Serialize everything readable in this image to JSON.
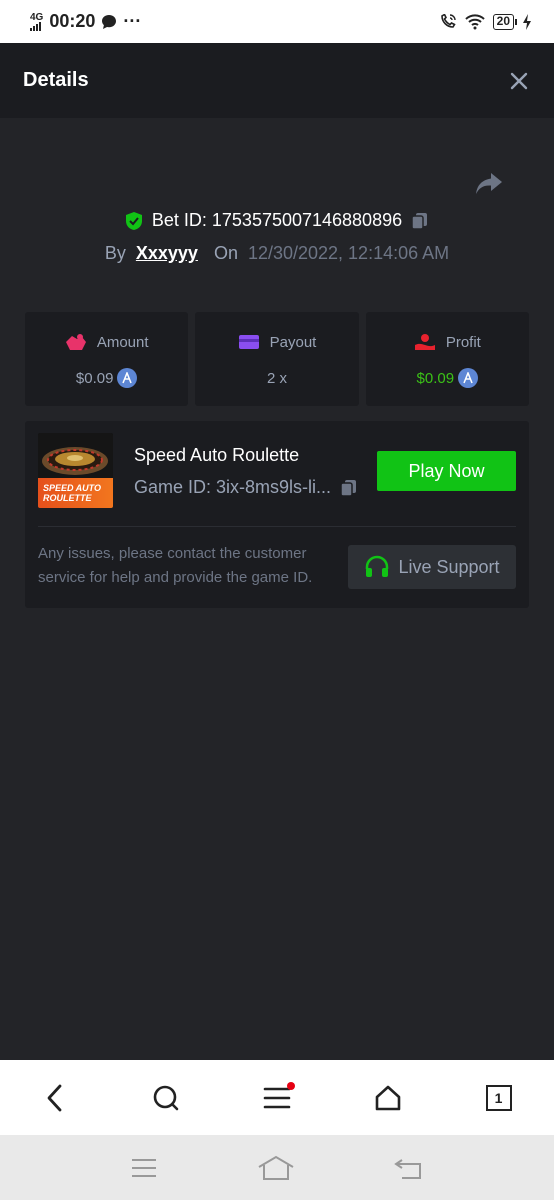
{
  "status_bar": {
    "network": "4G",
    "time": "00:20",
    "more": "···",
    "battery": "20"
  },
  "header": {
    "title": "Details"
  },
  "bet": {
    "bet_id_label": "Bet ID: 1753575007146880896",
    "by_label": "By",
    "username": "Xxxyyy",
    "on_label": "On",
    "date": "12/30/2022, 12:14:06 AM"
  },
  "stats": [
    {
      "label": "Amount",
      "value": "$0.09",
      "icon": "amount-icon",
      "icon_color": "#e8336a"
    },
    {
      "label": "Payout",
      "value": "2 x",
      "icon": "payout-card-icon",
      "icon_color": "#8a4ef0"
    },
    {
      "label": "Profit",
      "value": "$0.09",
      "icon": "profit-icon",
      "icon_color": "#e8222e",
      "value_color": "#3bc117"
    }
  ],
  "game": {
    "name": "Speed Auto Roulette",
    "game_id": "Game ID: 3ix-8ms9ls-li...",
    "thumb_line1": "SPEED AUTO",
    "thumb_line2": "ROULETTE",
    "play_label": "Play Now",
    "issues_text": "Any issues, please contact the customer service for help and provide the game ID.",
    "support_label": "Live Support"
  },
  "browser_nav": {
    "tab_count": "1"
  },
  "colors": {
    "accent_green": "#11c315",
    "panel": "#1b1c20",
    "background": "#232428"
  }
}
